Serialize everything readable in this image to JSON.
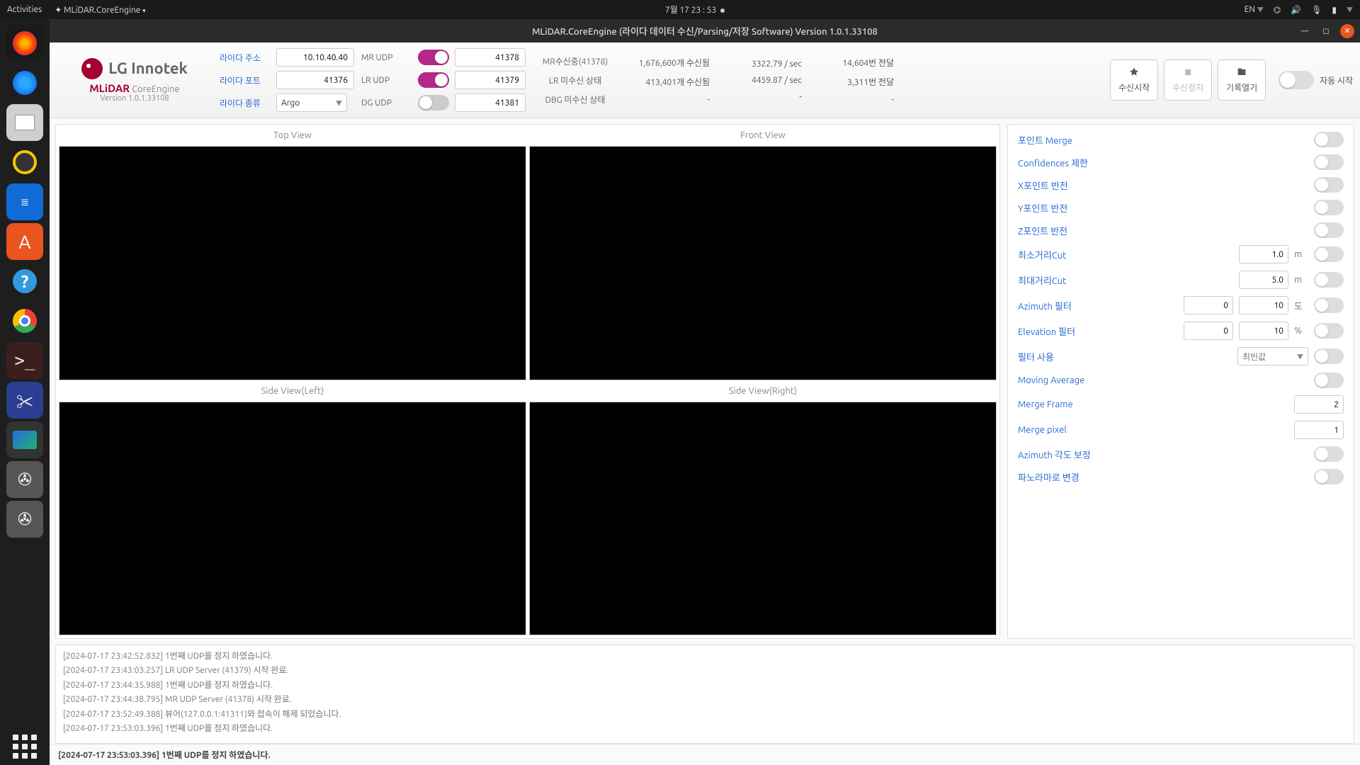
{
  "topbar": {
    "activities": "Activities",
    "appmenu": "MLiDAR.CoreEngine",
    "clock": "7월 17  23 : 53",
    "lang": "EN"
  },
  "window": {
    "title": "MLiDAR.CoreEngine (라이다 데이터 수신/Parsing/저장 Software) Version 1.0.1.33108"
  },
  "logo": {
    "brand": "LG Innotek",
    "app_a": "MLiDAR",
    "app_b": "CoreEngine",
    "version": "Version 1.0.1.33108"
  },
  "conn": {
    "addr_label": "라이다 주소",
    "addr": "10.10.40.40",
    "port_label": "라이다 포트",
    "port": "41376",
    "type_label": "라이다 종류",
    "type": "Argo"
  },
  "udp": {
    "mr_label": "MR UDP",
    "mr_port": "41378",
    "lr_label": "LR UDP",
    "lr_port": "41379",
    "dg_label": "DG UDP",
    "dg_port": "41381"
  },
  "stats": {
    "row1": {
      "a": "MR수신중(41378)",
      "b": "1,676,600개 수신됨",
      "c": "3322.79 / sec",
      "d": "14,604번 전달"
    },
    "row2": {
      "a": "LR 미수신 상태",
      "b": "413,401개 수신됨",
      "c": "4459.87 / sec",
      "d": "3,311번 전달"
    },
    "row3": {
      "a": "DBG 미수신 상태",
      "b": "-",
      "c": "-",
      "d": "-"
    }
  },
  "autostart_label": "자동 시작",
  "buttons": {
    "start": "수신시작",
    "stop": "수신정지",
    "open": "기록열기"
  },
  "views": {
    "top": "Top View",
    "front": "Front View",
    "left": "Side View(Left)",
    "right": "Side View(Right)"
  },
  "side": {
    "point_merge": "포인트 Merge",
    "confidence": "Confidences 제한",
    "x_inv": "X포인트 반전",
    "y_inv": "Y포인트 반전",
    "z_inv": "Z포인트 반전",
    "min_cut": "최소거리Cut",
    "min_cut_val": "1.0",
    "min_cut_unit": "m",
    "max_cut": "최대거리Cut",
    "max_cut_val": "5.0",
    "max_cut_unit": "m",
    "az_filter": "Azimuth 필터",
    "az_a": "0",
    "az_b": "10",
    "az_unit": "도",
    "el_filter": "Elevation 필터",
    "el_a": "0",
    "el_b": "10",
    "el_unit": "%",
    "filter_use": "필터 사용",
    "filter_sel": "최빈값",
    "mavg": "Moving Average",
    "merge_frame": "Merge Frame",
    "merge_frame_val": "2",
    "merge_pixel": "Merge pixel",
    "merge_pixel_val": "1",
    "az_corr": "Azimuth 각도 보정",
    "panorama": "파노라마로 변경"
  },
  "log": [
    "[2024-07-17 23:42:52.832] 1번째 UDP를 정지 하였습니다.",
    "[2024-07-17 23:43:03.257] LR UDP Server (41379)  시작 완료.",
    "[2024-07-17 23:44:35.988] 1번째 UDP를 정지 하였습니다.",
    "[2024-07-17 23:44:38.795] MR UDP Server (41378)  시작 완료.",
    "[2024-07-17 23:52:49.388] 뷰어(127.0.0.1:41311)와 접속이 해제 되었습니다.",
    "[2024-07-17 23:53:03.396] 1번째 UDP를 정지 하였습니다."
  ],
  "status": "[2024-07-17 23:53:03.396] 1번째 UDP를 정지 하였습니다."
}
